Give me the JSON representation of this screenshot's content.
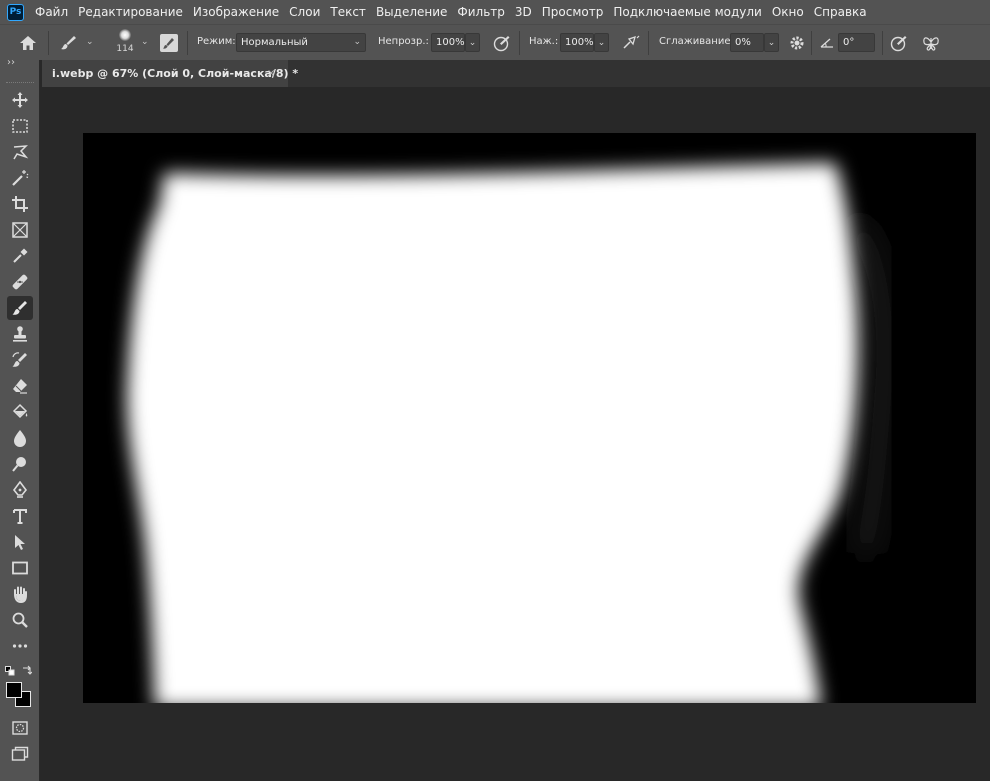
{
  "app": {
    "logo_text": "Ps"
  },
  "menu": [
    "Файл",
    "Редактирование",
    "Изображение",
    "Слои",
    "Текст",
    "Выделение",
    "Фильтр",
    "3D",
    "Просмотр",
    "Подключаемые модули",
    "Окно",
    "Справка"
  ],
  "options": {
    "brush_size": "114",
    "mode_label": "Режим:",
    "mode_value": "Нормальный",
    "opacity_label": "Непрозр.:",
    "opacity_value": "100%",
    "flow_label": "Наж.:",
    "flow_value": "100%",
    "smoothing_label": "Сглаживание:",
    "smoothing_value": "0%",
    "angle_value": "0°"
  },
  "document_tab": {
    "title": "i.webp @ 67% (Слой 0, Слой-маска/8) *",
    "close_glyph": "×"
  },
  "tools_panel": {
    "collapse_glyph": "››",
    "active_tool": "brush-tool"
  },
  "colors": {
    "chrome": "#535353",
    "workspace": "#282828",
    "foreground": "#000000",
    "background": "#000000",
    "accent": "#31a8ff"
  }
}
